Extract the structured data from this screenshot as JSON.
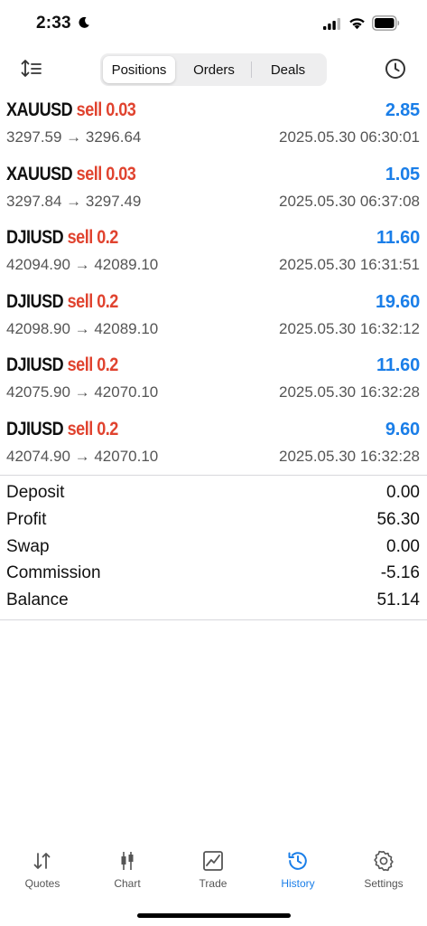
{
  "status_bar": {
    "time": "2:33"
  },
  "toolbar": {
    "segments": [
      "Positions",
      "Orders",
      "Deals"
    ],
    "active_segment": "Positions"
  },
  "positions": [
    {
      "symbol": "XAUUSD",
      "side": "sell 0.03",
      "profit": "2.85",
      "prices": "3297.59 → 3296.64",
      "time": "2025.05.30 06:30:01"
    },
    {
      "symbol": "XAUUSD",
      "side": "sell 0.03",
      "profit": "1.05",
      "prices": "3297.84 → 3297.49",
      "time": "2025.05.30 06:37:08"
    },
    {
      "symbol": "DJIUSD",
      "side": "sell 0.2",
      "profit": "11.60",
      "prices": "42094.90 → 42089.10",
      "time": "2025.05.30 16:31:51"
    },
    {
      "symbol": "DJIUSD",
      "side": "sell 0.2",
      "profit": "19.60",
      "prices": "42098.90 → 42089.10",
      "time": "2025.05.30 16:32:12"
    },
    {
      "symbol": "DJIUSD",
      "side": "sell 0.2",
      "profit": "11.60",
      "prices": "42075.90 → 42070.10",
      "time": "2025.05.30 16:32:28"
    },
    {
      "symbol": "DJIUSD",
      "side": "sell 0.2",
      "profit": "9.60",
      "prices": "42074.90 → 42070.10",
      "time": "2025.05.30 16:32:28"
    }
  ],
  "summary": [
    {
      "label": "Deposit",
      "value": "0.00"
    },
    {
      "label": "Profit",
      "value": "56.30"
    },
    {
      "label": "Swap",
      "value": "0.00"
    },
    {
      "label": "Commission",
      "value": "-5.16"
    },
    {
      "label": "Balance",
      "value": "51.14"
    }
  ],
  "tabbar": {
    "tabs": [
      {
        "label": "Quotes",
        "icon": "quotes-arrows-icon"
      },
      {
        "label": "Chart",
        "icon": "candlestick-icon"
      },
      {
        "label": "Trade",
        "icon": "trade-chart-icon"
      },
      {
        "label": "History",
        "icon": "history-clock-icon"
      },
      {
        "label": "Settings",
        "icon": "gear-icon"
      }
    ],
    "active_tab": "History"
  },
  "colors": {
    "accent_blue": "#1a7ee8",
    "sell_red": "#e0432f",
    "secondary_text": "#555555"
  }
}
